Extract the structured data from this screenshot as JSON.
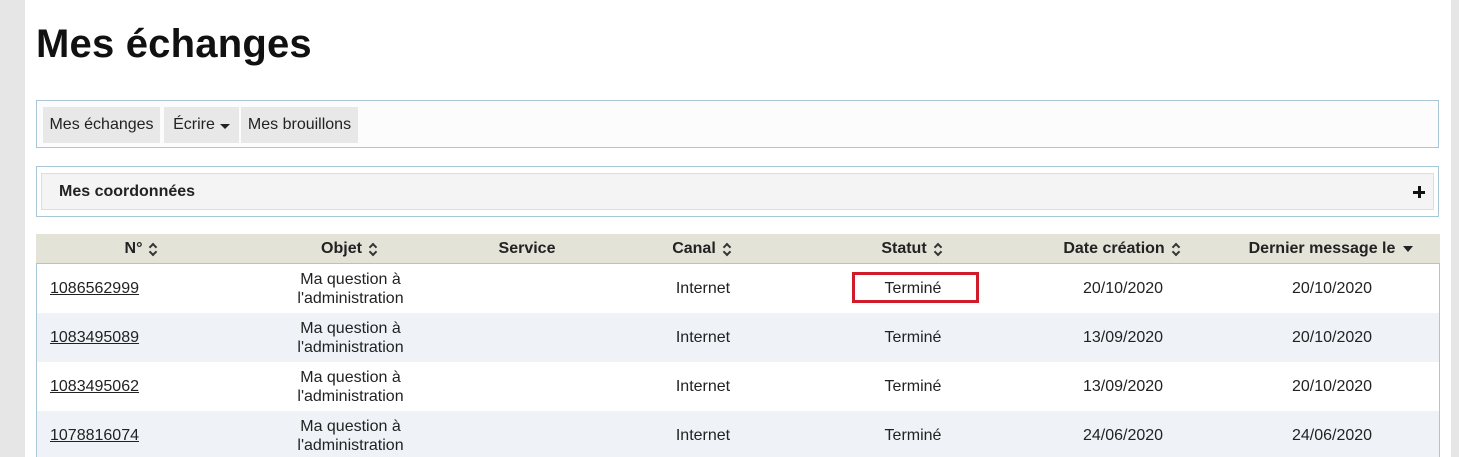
{
  "page": {
    "title": "Mes échanges"
  },
  "nav": {
    "items": [
      {
        "label": "Mes échanges"
      },
      {
        "label": "Écrire"
      },
      {
        "label": "Mes brouillons"
      }
    ]
  },
  "coordonnees": {
    "label": "Mes coordonnées"
  },
  "table": {
    "columns": [
      {
        "label": "N°"
      },
      {
        "label": "Objet"
      },
      {
        "label": "Service"
      },
      {
        "label": "Canal"
      },
      {
        "label": "Statut"
      },
      {
        "label": "Date création"
      },
      {
        "label": "Dernier message le"
      }
    ],
    "rows": [
      {
        "numero": "1086562999",
        "objet_line1": "Ma question à",
        "objet_line2": "l'administration",
        "service": "",
        "canal": "Internet",
        "statut": "Terminé",
        "date_creation": "20/10/2020",
        "dernier_message": "20/10/2020"
      },
      {
        "numero": "1083495089",
        "objet_line1": "Ma question à",
        "objet_line2": "l'administration",
        "service": "",
        "canal": "Internet",
        "statut": "Terminé",
        "date_creation": "13/09/2020",
        "dernier_message": "20/10/2020"
      },
      {
        "numero": "1083495062",
        "objet_line1": "Ma question à",
        "objet_line2": "l'administration",
        "service": "",
        "canal": "Internet",
        "statut": "Terminé",
        "date_creation": "13/09/2020",
        "dernier_message": "20/10/2020"
      },
      {
        "numero": "1078816074",
        "objet_line1": "Ma question à",
        "objet_line2": "l'administration",
        "service": "",
        "canal": "Internet",
        "statut": "Terminé",
        "date_creation": "24/06/2020",
        "dernier_message": "24/06/2020"
      }
    ]
  },
  "colors": {
    "highlight": "#d11a2a",
    "header_bg": "#e3e3d8",
    "border": "#a9c6d6",
    "row_alt": "#eff3f8"
  }
}
